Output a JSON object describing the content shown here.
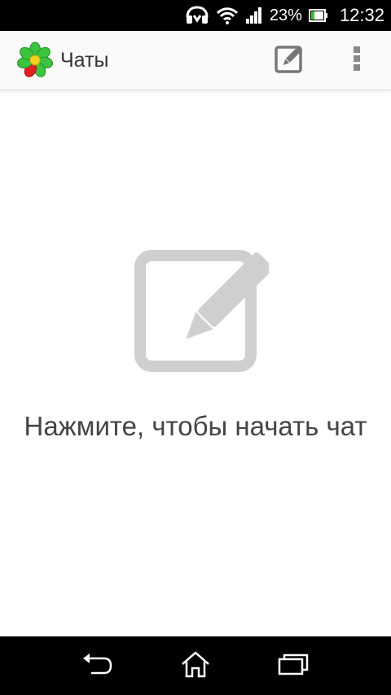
{
  "status_bar": {
    "battery_percent_text": "23%",
    "time": "12:32",
    "icons": [
      "headset-icon",
      "wifi-icon",
      "signal-icon",
      "battery-icon"
    ]
  },
  "app_bar": {
    "title": "Чаты",
    "logo_icon": "icq-flower-icon",
    "actions": [
      "compose-icon",
      "overflow-menu-icon"
    ]
  },
  "empty_state": {
    "message": "Нажмите, чтобы начать чат",
    "icon": "compose-icon"
  },
  "nav_bar": {
    "buttons": [
      "back-icon",
      "home-icon",
      "recent-apps-icon"
    ]
  },
  "colors": {
    "status_bar_bg": "#000000",
    "app_bar_bg": "#fafafa",
    "icon_gray": "#cfcfcf",
    "toolbar_icon_gray": "#777777",
    "text_dark": "#444444",
    "icq_green": "#3cc43c",
    "icq_red": "#e02020",
    "icq_yellow": "#f2d21a"
  }
}
